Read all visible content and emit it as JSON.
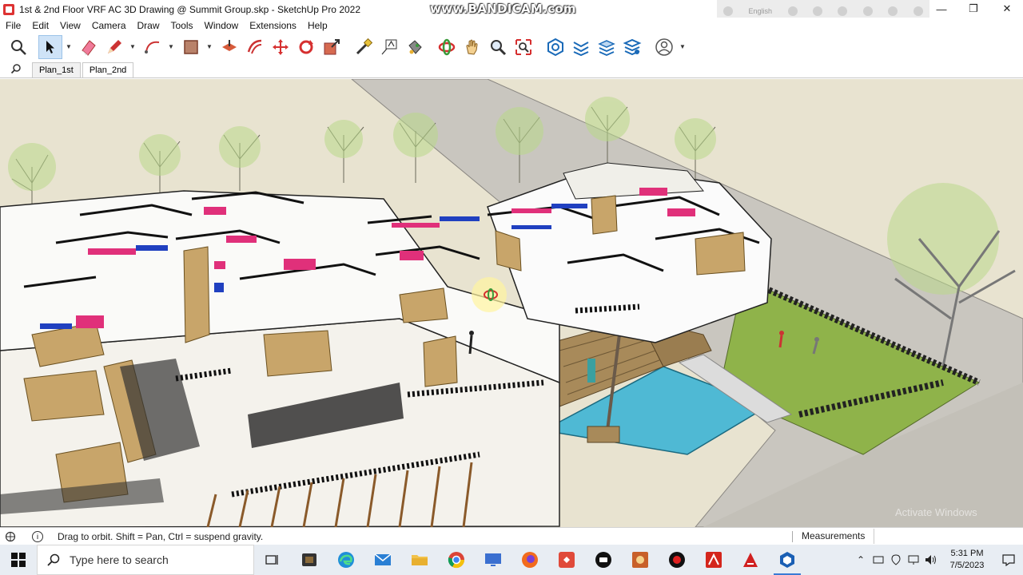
{
  "window": {
    "title": "1st & 2nd Floor VRF AC 3D Drawing  @ Summit Group.skp - SketchUp Pro 2022",
    "recorder_watermark": "www.BANDICAM.com",
    "recorder_language": "English"
  },
  "menu": {
    "items": [
      "File",
      "Edit",
      "View",
      "Camera",
      "Draw",
      "Tools",
      "Window",
      "Extensions",
      "Help"
    ]
  },
  "toolbar": {
    "tools": [
      {
        "name": "search-icon"
      },
      {
        "name": "select-icon",
        "active": true,
        "dropdown": true
      },
      {
        "name": "eraser-icon"
      },
      {
        "name": "pencil-icon",
        "dropdown": true
      },
      {
        "name": "arc-icon",
        "dropdown": true
      },
      {
        "name": "rectangle-icon",
        "dropdown": true
      },
      {
        "name": "push-pull-icon"
      },
      {
        "name": "offset-icon"
      },
      {
        "name": "move-icon"
      },
      {
        "name": "rotate-icon"
      },
      {
        "name": "scale-icon"
      },
      {
        "name": "tape-measure-icon"
      },
      {
        "name": "text-icon"
      },
      {
        "name": "paint-bucket-icon"
      },
      {
        "name": "orbit-icon"
      },
      {
        "name": "pan-icon"
      },
      {
        "name": "zoom-icon"
      },
      {
        "name": "zoom-extents-icon"
      },
      {
        "name": "warehouse-icon"
      },
      {
        "name": "extension-warehouse-icon"
      },
      {
        "name": "layout-icon"
      },
      {
        "name": "extension-manager-icon"
      },
      {
        "name": "user-account-icon",
        "dropdown": true
      }
    ]
  },
  "scenes": {
    "tabs": [
      "Plan_1st",
      "Plan_2nd"
    ]
  },
  "statusbar": {
    "hint": "Drag to orbit. Shift = Pan, Ctrl = suspend gravity.",
    "measurements_label": "Measurements",
    "measurements_value": "",
    "viewport_overlay": "Activate Windows"
  },
  "taskbar": {
    "search_placeholder": "Type here to search",
    "time": "5:31 PM",
    "date": "7/5/2023"
  },
  "colors": {
    "sky": "#e8e3d0",
    "ground": "#c8c5be",
    "lawn": "#8fb34a",
    "pool": "#4fb9d4",
    "deck": "#a88a5a",
    "wall_accent": "#c8a56a",
    "ac_pink": "#e0307a",
    "ac_blue": "#2040c0"
  }
}
